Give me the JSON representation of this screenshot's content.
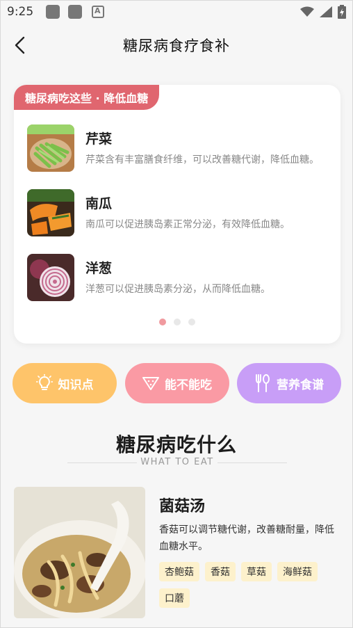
{
  "status_bar": {
    "time": "9:25",
    "icons": [
      "notification-square-icon",
      "notification-square-icon",
      "a-letter-icon",
      "wifi-icon",
      "signal-icon",
      "battery-icon"
    ]
  },
  "header": {
    "title": "糖尿病食疗食补",
    "back_icon": "chevron-left-icon"
  },
  "featured_card": {
    "badge": "糖尿病吃这些 · 降低血糖",
    "items": [
      {
        "name": "芹菜",
        "desc": "芹菜含有丰富膳食纤维，可以改善糖代谢，降低血糖。"
      },
      {
        "name": "南瓜",
        "desc": "南瓜可以促进胰岛素正常分泌，有效降低血糖。"
      },
      {
        "name": "洋葱",
        "desc": "洋葱可以促进胰岛素分泌，从而降低血糖。"
      }
    ],
    "page_count": 3,
    "active_page": 1
  },
  "categories": [
    {
      "label": "知识点",
      "icon": "lightbulb-icon",
      "color": "#fec46a"
    },
    {
      "label": "能不能吃",
      "icon": "watermelon-icon",
      "color": "#fa9aa4"
    },
    {
      "label": "营养食谱",
      "icon": "fork-spoon-icon",
      "color": "#c89ef7"
    }
  ],
  "section": {
    "title": "糖尿病吃什么",
    "subtitle": "WHAT TO EAT"
  },
  "recipe": {
    "name": "菌菇汤",
    "desc": "香菇可以调节糖代谢，改善糖耐量，降低血糖水平。",
    "tags": [
      "杏鲍菇",
      "香菇",
      "草菇",
      "海鲜菇",
      "口蘑"
    ]
  }
}
